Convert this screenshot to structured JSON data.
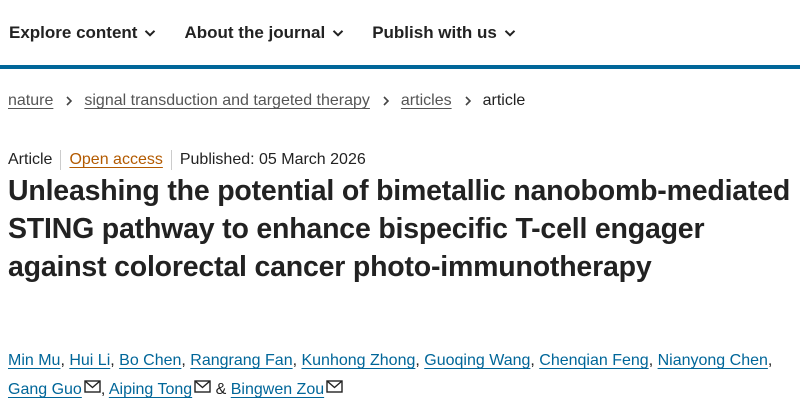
{
  "nav": {
    "items": [
      {
        "label": "Explore content"
      },
      {
        "label": "About the journal"
      },
      {
        "label": "Publish with us"
      }
    ],
    "accent_color": "#006699"
  },
  "breadcrumb": {
    "items": [
      "nature",
      "signal transduction and targeted therapy",
      "articles"
    ],
    "current": "article"
  },
  "meta": {
    "type": "Article",
    "access": "Open access",
    "published": "Published: 05 March 2026"
  },
  "title": "Unleashing the potential of bimetallic nanobomb-mediated STING pathway to enhance bispecific T-cell engager against colorectal cancer photo-immunotherapy",
  "authors": {
    "names": [
      "Min Mu",
      "Hui Li",
      "Bo Chen",
      "Rangrang Fan",
      "Kunhong Zhong",
      "Guoqing Wang",
      "Chenqian Feng",
      "Nianyong Chen",
      "Gang Guo",
      "Aiping Tong",
      "Bingwen Zou"
    ],
    "separator": ", ",
    "last_separator": " & "
  },
  "icons": {
    "nav_chevron": "chevron-down-icon",
    "breadcrumb_separator": "chevron-right-icon",
    "author_email": "email-icon"
  },
  "colors": {
    "link": "#006699",
    "open_access": "#b35a00",
    "text": "#222222"
  }
}
